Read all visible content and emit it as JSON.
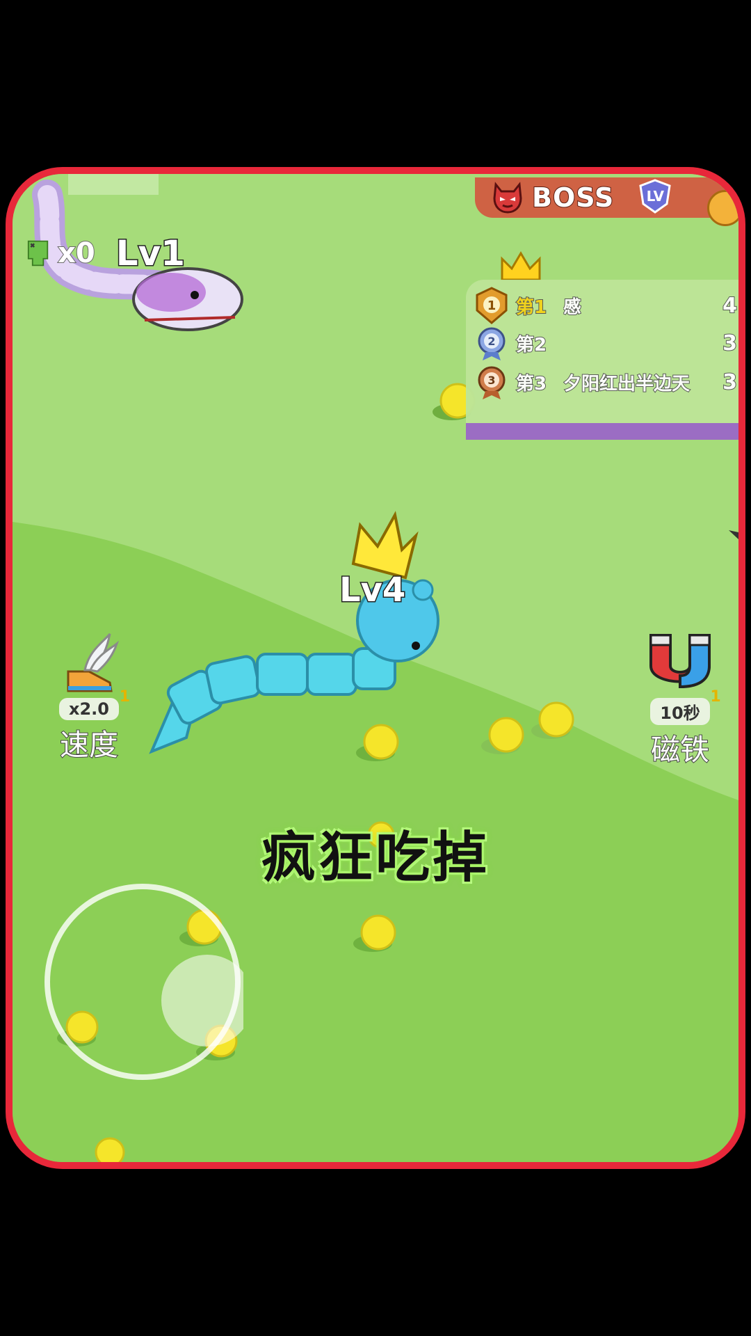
{
  "hud": {
    "boss_label": "BOSS",
    "lv_badge": "LV",
    "kill_count": "x0",
    "player_level": "Lv1"
  },
  "leaderboard": {
    "rows": [
      {
        "position": "第1",
        "name": "慼",
        "score": "4"
      },
      {
        "position": "第2",
        "name": "",
        "score": "3"
      },
      {
        "position": "第3",
        "name": "夕阳红出半边天",
        "score": "3"
      }
    ]
  },
  "player_snake": {
    "level": "Lv4",
    "color": "#55d6ea"
  },
  "enemy_snake": {
    "color": "#c9b0e8"
  },
  "boosts": {
    "speed": {
      "multiplier": "x2.0",
      "count": "1",
      "label": "速度"
    },
    "magnet": {
      "duration": "10秒",
      "count": "1",
      "label": "磁铁"
    }
  },
  "subtitle": "疯狂吃掉",
  "colors": {
    "frame": "#e8283a",
    "grass_light": "#a6dc7a",
    "grass_dark": "#8ccf56",
    "food": "#f5e52a",
    "boss_bar": "#cf6244",
    "rank_strip": "#9b69c7"
  },
  "icons": [
    "demon-face-icon",
    "lv-shield-icon",
    "skull-icon",
    "crown-icon",
    "medal-icon",
    "winged-shoe-icon",
    "magnet-icon"
  ]
}
